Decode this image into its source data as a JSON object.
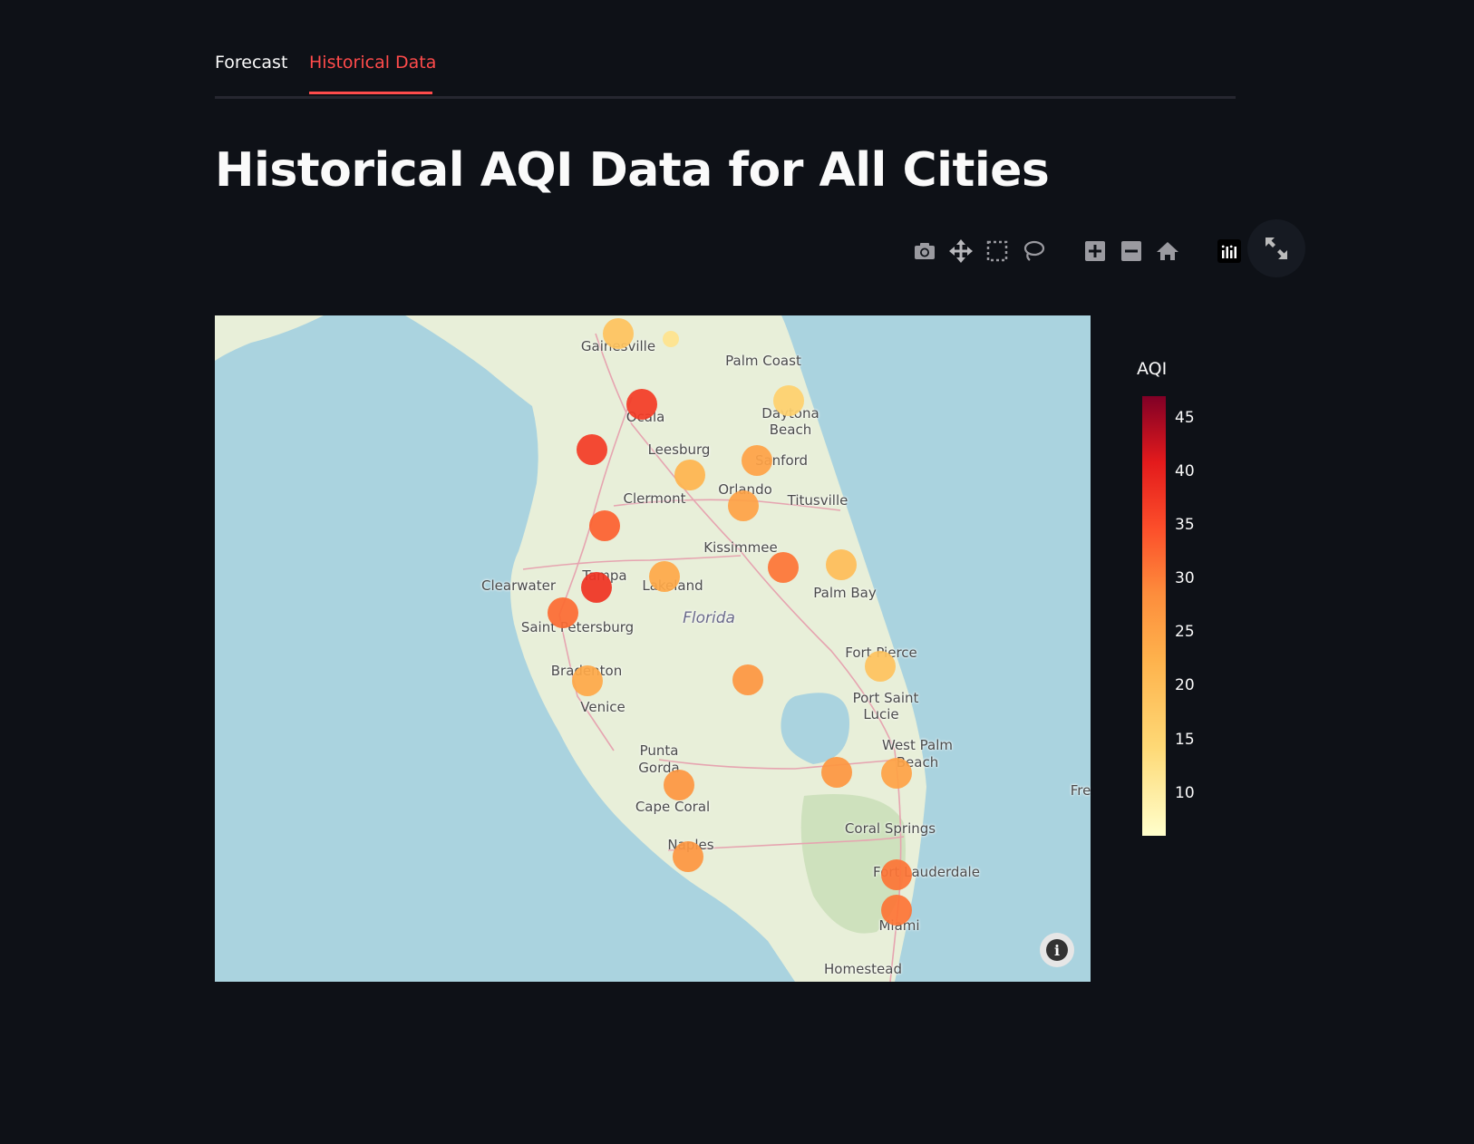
{
  "tabs": [
    {
      "label": "Forecast",
      "active": false
    },
    {
      "label": "Historical Data",
      "active": true
    }
  ],
  "page_title": "Historical AQI Data for All Cities",
  "modebar": [
    "camera-icon",
    "pan-icon",
    "box-select-icon",
    "lasso-icon",
    "zoom-in-icon",
    "zoom-out-icon",
    "reset-home-icon",
    "plotly-logo-icon"
  ],
  "fullscreen": "expand-icon",
  "colors": {
    "accent": "#ff4b4b",
    "background": "#0e1117",
    "water": "#aad3df",
    "land": "#e8efd9"
  },
  "map": {
    "labels": [
      {
        "text": "Gainesville"
      },
      {
        "text": "Palm Coast"
      },
      {
        "text": "Daytona"
      },
      {
        "text": "Beach"
      },
      {
        "text": "Ocala"
      },
      {
        "text": "Leesburg"
      },
      {
        "text": "Sanford"
      },
      {
        "text": "Orlando"
      },
      {
        "text": "Clermont"
      },
      {
        "text": "Titusville"
      },
      {
        "text": "Kissimmee"
      },
      {
        "text": "Clearwater"
      },
      {
        "text": "Tampa"
      },
      {
        "text": "Lakeland"
      },
      {
        "text": "Palm Bay"
      },
      {
        "text": "Florida"
      },
      {
        "text": "Saint Petersburg"
      },
      {
        "text": "Fort Pierce"
      },
      {
        "text": "Bradenton"
      },
      {
        "text": "Port Saint"
      },
      {
        "text": "Lucie"
      },
      {
        "text": "Venice"
      },
      {
        "text": "West Palm"
      },
      {
        "text": "Beach"
      },
      {
        "text": "Punta"
      },
      {
        "text": "Gorda"
      },
      {
        "text": "Cape Coral"
      },
      {
        "text": "Coral Springs"
      },
      {
        "text": "Naples"
      },
      {
        "text": "Fort Lauderdale"
      },
      {
        "text": "Miami"
      },
      {
        "text": "Homestead"
      },
      {
        "text": "Fre"
      }
    ],
    "info_icon": "info-icon"
  },
  "chart_data": {
    "type": "scatter",
    "colorbar": {
      "title": "AQI",
      "ticks": [
        "45",
        "40",
        "35",
        "30",
        "25",
        "20",
        "15",
        "10"
      ],
      "range": [
        6,
        47
      ],
      "colorscale": "YlOrRd"
    },
    "points": [
      {
        "aqi": 19
      },
      {
        "aqi": 12
      },
      {
        "aqi": 37
      },
      {
        "aqi": 16
      },
      {
        "aqi": 37
      },
      {
        "aqi": 22
      },
      {
        "aqi": 25
      },
      {
        "aqi": 25
      },
      {
        "aqi": 33
      },
      {
        "aqi": 38
      },
      {
        "aqi": 24
      },
      {
        "aqi": 32
      },
      {
        "aqi": 20
      },
      {
        "aqi": 31
      },
      {
        "aqi": 24
      },
      {
        "aqi": 19
      },
      {
        "aqi": 27
      },
      {
        "aqi": 27
      },
      {
        "aqi": 25
      },
      {
        "aqi": 27
      },
      {
        "aqi": 27
      },
      {
        "aqi": 31
      },
      {
        "aqi": 31
      }
    ]
  }
}
